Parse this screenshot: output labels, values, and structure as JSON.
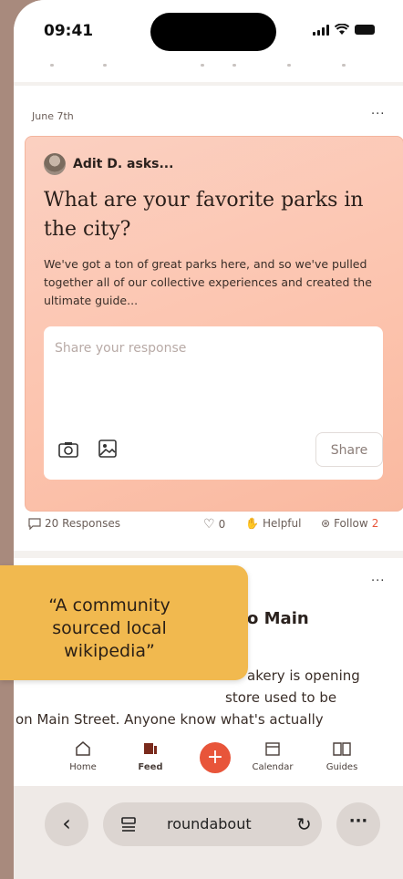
{
  "status": {
    "time": "09:41"
  },
  "post": {
    "date": "June 7th",
    "menu": "···",
    "asker": "Adit D. asks...",
    "title": "What are your favorite parks in the city?",
    "description": "We've got a ton of great parks here, and so we've pulled together all of our collective experiences and created the ultimate guide...",
    "response_placeholder": "Share your response",
    "share_label": "Share",
    "responses": "20 Responses",
    "likes": "0",
    "helpful": "Helpful",
    "follow": "Follow",
    "follow_count": "2"
  },
  "next_post": {
    "menu": "···",
    "title_fragment": "o Main",
    "line1": "akery is opening",
    "line2": "store used to be",
    "line3": "on Main Street. Anyone know what's actually"
  },
  "tabs": [
    {
      "label": "Home",
      "icon": "home-icon"
    },
    {
      "label": "Feed",
      "icon": "feed-icon"
    },
    {
      "label": "Calendar",
      "icon": "calendar-icon"
    },
    {
      "label": "Guides",
      "icon": "guides-icon"
    }
  ],
  "browser": {
    "url": "roundabout",
    "back": "‹",
    "more": "···"
  },
  "callout": {
    "text": "“A community sourced local wikipedia”"
  },
  "colors": {
    "accent": "#e8553a",
    "callout": "#f1b94f",
    "card": "#fcc3ad"
  }
}
